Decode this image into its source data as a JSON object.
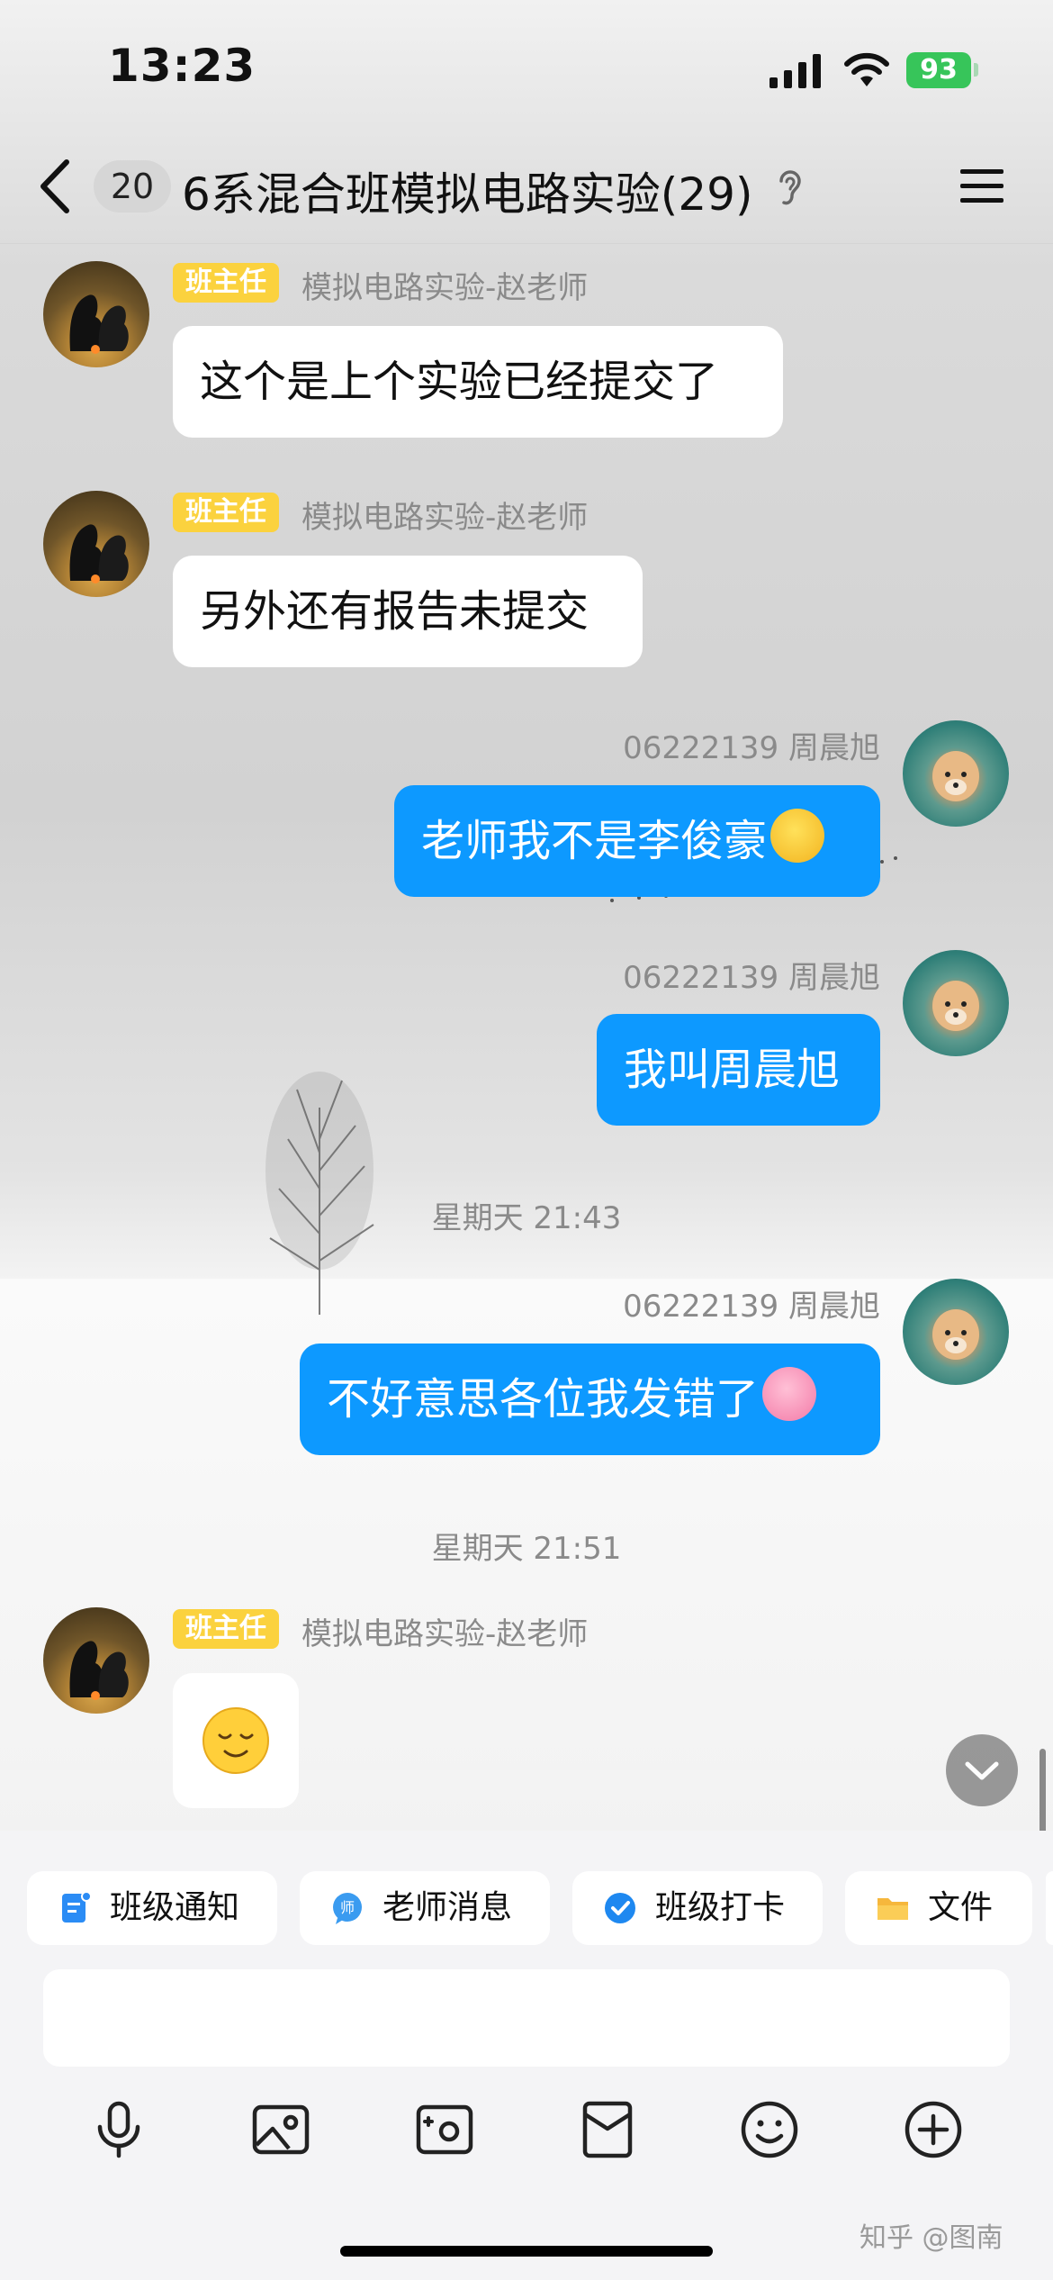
{
  "status_bar": {
    "time": "13:23",
    "battery": "93"
  },
  "header": {
    "unread_count": "20",
    "title": "6系混合班模拟电路实验(29)"
  },
  "messages": [
    {
      "role_tag": "班主任",
      "sender": "模拟电路实验-赵老师",
      "text": "这个是上个实验已经提交了"
    },
    {
      "role_tag": "班主任",
      "sender": "模拟电路实验-赵老师",
      "text": "另外还有报告未提交"
    },
    {
      "sender": "06222139 周晨旭",
      "text": "老师我不是李俊豪"
    },
    {
      "sender": "06222139 周晨旭",
      "text": "我叫周晨旭"
    },
    {
      "timestamp": "星期天 21:43"
    },
    {
      "sender": "06222139 周晨旭",
      "text": "不好意思各位我发错了"
    },
    {
      "timestamp": "星期天 21:51"
    },
    {
      "role_tag": "班主任",
      "sender": "模拟电路实验-赵老师",
      "emoji": "smile-emoji"
    }
  ],
  "quick_actions": [
    {
      "label": "班级通知",
      "icon": "notice-icon",
      "color": "#2b8cf5"
    },
    {
      "label": "老师消息",
      "icon": "teacher-message-icon",
      "color": "#3a9bf0"
    },
    {
      "label": "班级打卡",
      "icon": "checkin-icon",
      "color": "#1e88f0"
    },
    {
      "label": "文件",
      "icon": "folder-icon",
      "color": "#f6b73c"
    }
  ],
  "input": {
    "value": ""
  },
  "toolbar": [
    "microphone-icon",
    "image-icon",
    "camera-icon",
    "red-packet-icon",
    "emoji-icon",
    "plus-icon"
  ],
  "watermark": "知乎 @图南",
  "colors": {
    "bubble_out": "#0d99ff",
    "role_tag": "#fbd23e"
  }
}
